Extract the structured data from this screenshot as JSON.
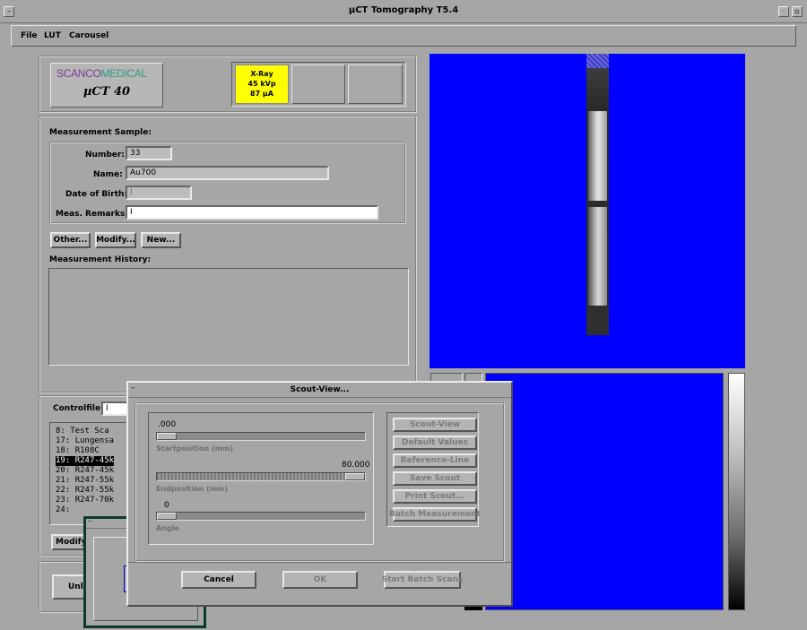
{
  "window": {
    "title": "µCT Tomography T5.4"
  },
  "menu": [
    "File",
    "LUT",
    "Carousel"
  ],
  "logo": {
    "brand_left": "SCANCO",
    "brand_right": "MEDICAL",
    "model": "µCT 40"
  },
  "xray": {
    "line1": "X-Ray",
    "line2": "45 kVp",
    "line3": "87 µA"
  },
  "sample": {
    "heading": "Measurement Sample:",
    "number_label": "Number:",
    "number_value": "33",
    "name_label": "Name:",
    "name_value": "Au700",
    "dob_label": "Date of Birth:",
    "dob_value": "",
    "remarks_label": "Meas. Remarks:",
    "remarks_value": "",
    "btn_other": "Other...",
    "btn_modify": "Modify...",
    "btn_new": "New...",
    "history_heading": "Measurement History:"
  },
  "control": {
    "label": "Controlfile:",
    "rows": [
      {
        "num": " 8:",
        "text": "Test Sca"
      },
      {
        "num": "17:",
        "text": "Lungensa"
      },
      {
        "num": "18:",
        "text": "R108C"
      },
      {
        "num": "19:",
        "text": "R247-45k"
      },
      {
        "num": "20:",
        "text": "R247-45k"
      },
      {
        "num": "21:",
        "text": "R247-55k"
      },
      {
        "num": "22:",
        "text": "R247-55k"
      },
      {
        "num": "23:",
        "text": "R247-70k"
      },
      {
        "num": "24:",
        "text": ""
      }
    ],
    "selected_index": 3,
    "btn_modify": "Modify",
    "btn_unl": "Unl"
  },
  "scout": {
    "title": "Scout-View...",
    "start_value": ".000",
    "start_label": "Startposition (mm)",
    "start_fraction": 0,
    "end_value": "80.000",
    "end_label": "Endposition (mm)",
    "end_fraction": 1,
    "angle_value": "0",
    "angle_label": "Angle",
    "angle_fraction": 0,
    "side_buttons": [
      "Scout-View",
      "Default Values",
      "Reference-Line",
      "Save Scout",
      "Print Scout...",
      "Batch Measurement"
    ],
    "btn_cancel": "Cancel",
    "btn_ok": "OK",
    "btn_batch": "Start Batch Scans"
  },
  "colors": {
    "view_bg": "#0000ff",
    "xray_badge": "#ffff00",
    "dialog_frame": "#0e3a2c"
  }
}
